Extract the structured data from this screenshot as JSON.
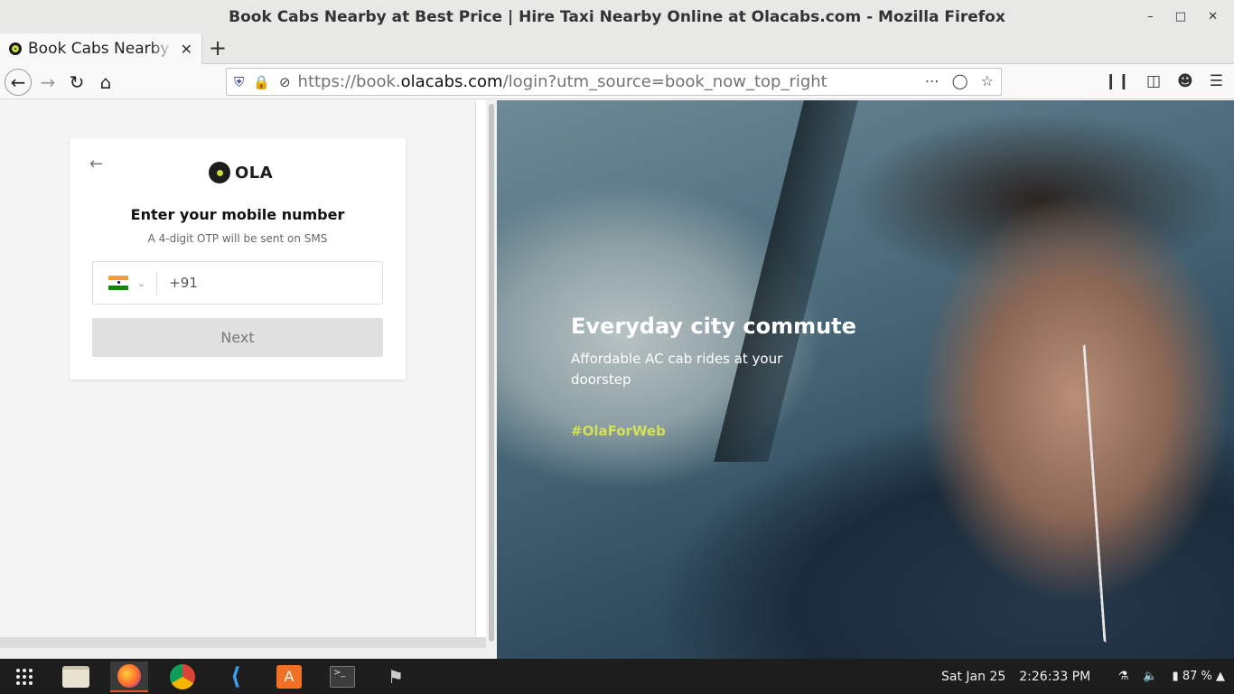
{
  "window": {
    "title": "Book Cabs Nearby at Best Price | Hire Taxi Nearby Online at Olacabs.com - Mozilla Firefox"
  },
  "tabs": [
    {
      "label": "Book Cabs Nearby at Best Price",
      "active": true
    }
  ],
  "navbar": {
    "url_prefix": "https://book.",
    "url_domain": "olacabs.com",
    "url_suffix": "/login?utm_source=book_now_top_right"
  },
  "login_card": {
    "logo_text": "OLA",
    "heading": "Enter your mobile number",
    "subheading": "A 4-digit OTP will be sent on SMS",
    "country_code": "+91",
    "next_label": "Next"
  },
  "hero": {
    "headline": "Everyday city commute",
    "tagline": "Affordable AC cab rides at your doorstep",
    "hashtag": "#OlaForWeb"
  },
  "taskbar": {
    "date": "Sat Jan 25",
    "time": "2:26:33 PM",
    "battery": "87 %",
    "apps": [
      "show-applications",
      "files",
      "firefox",
      "chrome",
      "vscode",
      "software-center",
      "terminal",
      "gimp"
    ]
  },
  "colors": {
    "ola_lime": "#cddc39",
    "hashtag": "#d4e157",
    "ubuntu_accent": "#e95420"
  }
}
